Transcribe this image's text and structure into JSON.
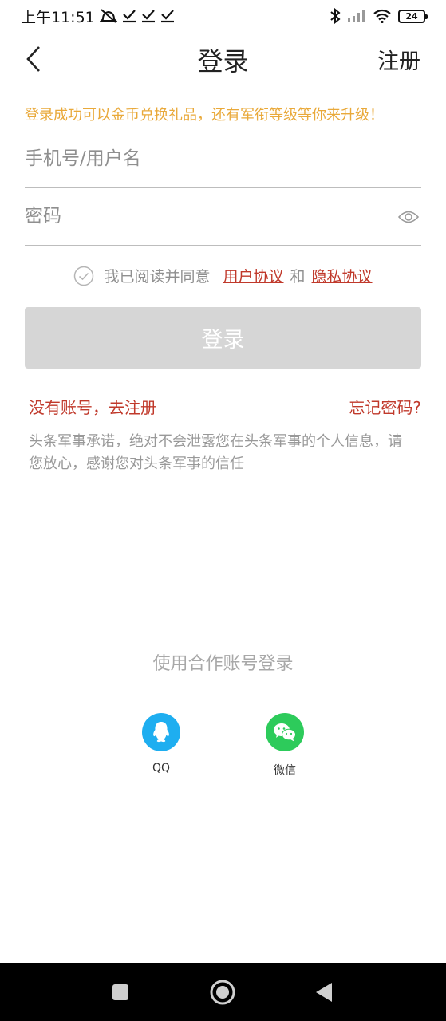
{
  "status_bar": {
    "time": "上午11:51",
    "battery": "24"
  },
  "header": {
    "title": "登录",
    "register": "注册"
  },
  "promo": "登录成功可以金币兑换礼品，还有军衔等级等你来升级！",
  "form": {
    "username_placeholder": "手机号/用户名",
    "password_placeholder": "密码",
    "username_value": "",
    "password_value": ""
  },
  "agreement": {
    "prefix": "我已阅读并同意",
    "user_agreement": "用户协议",
    "and": "和",
    "privacy_agreement": "隐私协议"
  },
  "login_button": "登录",
  "links": {
    "no_account": "没有账号，去注册",
    "forgot_password": "忘记密码?"
  },
  "privacy_note": "头条军事承诺，绝对不会泄露您在头条军事的个人信息，请您放心，感谢您对头条军事的信任",
  "partner": {
    "label": "使用合作账号登录",
    "options": [
      {
        "label": "QQ",
        "icon": "qq-icon",
        "color": "#1eaef0"
      },
      {
        "label": "微信",
        "icon": "wechat-icon",
        "color": "#2dcb5b"
      }
    ]
  },
  "colors": {
    "accent_red": "#c0392b",
    "promo_orange": "#e9a93a",
    "button_disabled": "#d6d6d6"
  }
}
